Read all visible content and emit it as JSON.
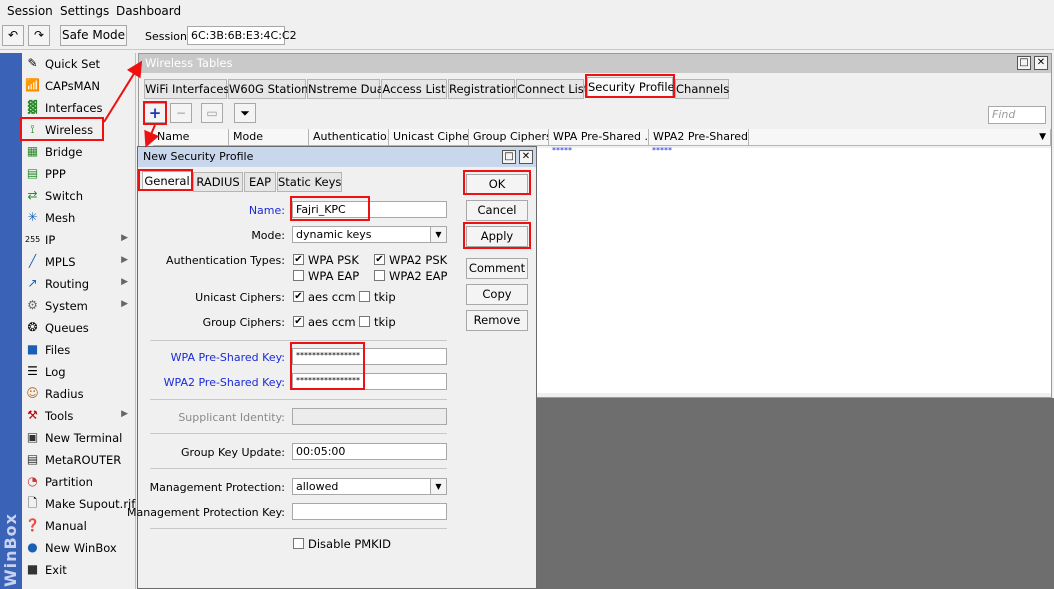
{
  "menu": [
    "Session",
    "Settings",
    "Dashboard"
  ],
  "toolbar": {
    "undo_icon": "undo-icon",
    "redo_icon": "redo-icon",
    "safe_mode": "Safe Mode",
    "session_label": "Session:",
    "session_value": "6C:3B:6B:E3:4C:C2"
  },
  "brand": "WinBox",
  "sidebar": {
    "items": [
      {
        "label": "Quick Set",
        "icon": "quick-set-icon"
      },
      {
        "label": "CAPsMAN",
        "icon": "capsman-icon"
      },
      {
        "label": "Interfaces",
        "icon": "interfaces-icon"
      },
      {
        "label": "Wireless",
        "icon": "wireless-icon"
      },
      {
        "label": "Bridge",
        "icon": "bridge-icon"
      },
      {
        "label": "PPP",
        "icon": "ppp-icon"
      },
      {
        "label": "Switch",
        "icon": "switch-icon"
      },
      {
        "label": "Mesh",
        "icon": "mesh-icon"
      },
      {
        "label": "IP",
        "icon": "ip-icon",
        "submenu": true
      },
      {
        "label": "MPLS",
        "icon": "mpls-icon",
        "submenu": true
      },
      {
        "label": "Routing",
        "icon": "routing-icon",
        "submenu": true
      },
      {
        "label": "System",
        "icon": "system-icon",
        "submenu": true
      },
      {
        "label": "Queues",
        "icon": "queues-icon"
      },
      {
        "label": "Files",
        "icon": "files-icon"
      },
      {
        "label": "Log",
        "icon": "log-icon"
      },
      {
        "label": "Radius",
        "icon": "radius-icon"
      },
      {
        "label": "Tools",
        "icon": "tools-icon",
        "submenu": true
      },
      {
        "label": "New Terminal",
        "icon": "terminal-icon"
      },
      {
        "label": "MetaROUTER",
        "icon": "metarouter-icon"
      },
      {
        "label": "Partition",
        "icon": "partition-icon"
      },
      {
        "label": "Make Supout.rif",
        "icon": "supout-icon"
      },
      {
        "label": "Manual",
        "icon": "manual-icon"
      },
      {
        "label": "New WinBox",
        "icon": "new-winbox-icon"
      },
      {
        "label": "Exit",
        "icon": "exit-icon"
      }
    ]
  },
  "wireless_tables": {
    "title": "Wireless Tables",
    "tabs": [
      "WiFi Interfaces",
      "W60G Station",
      "Nstreme Dual",
      "Access List",
      "Registration",
      "Connect List",
      "Security Profiles",
      "Channels"
    ],
    "active_tab": "Security Profiles",
    "find_placeholder": "Find",
    "columns": [
      "Name",
      "Mode",
      "Authenticatio...",
      "Unicast Ciphers",
      "Group Ciphers",
      "WPA Pre-Shared ...",
      "WPA2 Pre-Shared..."
    ],
    "row_masked": [
      "*****",
      "*****"
    ]
  },
  "dialog": {
    "title": "New Security Profile",
    "tabs": [
      "General",
      "RADIUS",
      "EAP",
      "Static Keys"
    ],
    "active_tab": "General",
    "name_label": "Name:",
    "name_value": "Fajri_KPC",
    "mode_label": "Mode:",
    "mode_value": "dynamic keys",
    "auth_label": "Authentication Types:",
    "auth_options": [
      {
        "label": "WPA PSK",
        "checked": true
      },
      {
        "label": "WPA2 PSK",
        "checked": true
      },
      {
        "label": "WPA EAP",
        "checked": false
      },
      {
        "label": "WPA2 EAP",
        "checked": false
      }
    ],
    "unicast_label": "Unicast Ciphers:",
    "unicast_options": [
      {
        "label": "aes ccm",
        "checked": true
      },
      {
        "label": "tkip",
        "checked": false
      }
    ],
    "group_label": "Group Ciphers:",
    "group_options": [
      {
        "label": "aes ccm",
        "checked": true
      },
      {
        "label": "tkip",
        "checked": false
      }
    ],
    "wpa_psk_label": "WPA Pre-Shared Key:",
    "wpa_psk_value": "****************",
    "wpa2_psk_label": "WPA2 Pre-Shared Key:",
    "wpa2_psk_value": "****************",
    "supplicant_label": "Supplicant Identity:",
    "supplicant_value": "",
    "group_key_update_label": "Group Key Update:",
    "group_key_update_value": "00:05:00",
    "mgmt_protection_label": "Management Protection:",
    "mgmt_protection_value": "allowed",
    "mgmt_key_label": "Management Protection Key:",
    "mgmt_key_value": "",
    "disable_pmkid_label": "Disable PMKID",
    "disable_pmkid_checked": false,
    "buttons": {
      "ok": "OK",
      "cancel": "Cancel",
      "apply": "Apply",
      "comment": "Comment",
      "copy": "Copy",
      "remove": "Remove"
    }
  },
  "colors": {
    "highlight": "#ee1111",
    "sidebar_strip": "#3a63b8",
    "blue_label": "#1a2bd6"
  }
}
